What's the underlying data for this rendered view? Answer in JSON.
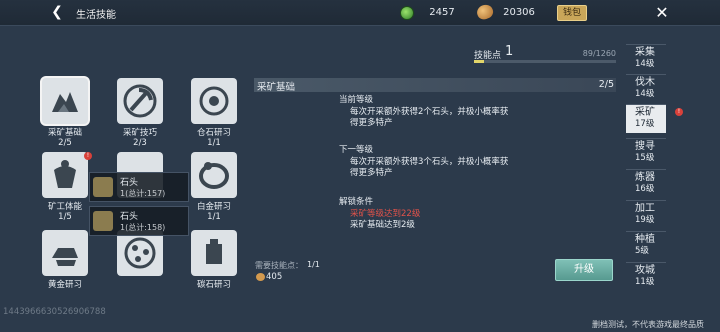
{
  "header": {
    "title": "生活技能",
    "currency_green": "2457",
    "currency_gold": "20306",
    "wallet_label": "钱包"
  },
  "skill_points": {
    "label": "技能点",
    "value": "1",
    "progress_text": "89/1260",
    "progress_fraction": 0.071
  },
  "skills": [
    {
      "name": "采矿基础",
      "level": "2/5"
    },
    {
      "name": "采矿技巧",
      "level": "2/3"
    },
    {
      "name": "仓石研习",
      "level": "1/1"
    },
    {
      "name": "矿工体能",
      "level": "1/5"
    },
    {
      "name": "",
      "level": ""
    },
    {
      "name": "白金研习",
      "level": "1/1"
    },
    {
      "name": "黄金研习",
      "level": ""
    },
    {
      "name": "",
      "level": ""
    },
    {
      "name": "碳石研习",
      "level": ""
    }
  ],
  "popups": [
    {
      "name": "石头",
      "total": "1(总计:157)"
    },
    {
      "name": "石头",
      "total": "1(总计:158)"
    }
  ],
  "detail": {
    "title": "采矿基础",
    "level": "2/5",
    "current_label": "当前等级",
    "current_desc_1": "每次开采额外获得2个石头，并极小概率获",
    "current_desc_2": "得更多特产",
    "next_label": "下一等级",
    "next_desc_1": "每次开采额外获得3个石头，并极小概率获",
    "next_desc_2": "得更多特产",
    "unlock_label": "解锁条件",
    "unlock_req_1": "采矿等级达到22级",
    "unlock_req_2": "采矿基础达到2级",
    "cost_label": "需要技能点：",
    "cost_value": "1/1",
    "cost_money": "405",
    "upgrade_label": "升级"
  },
  "side_tabs": [
    {
      "name": "采集",
      "level": "14级"
    },
    {
      "name": "伐木",
      "level": "14级"
    },
    {
      "name": "采矿",
      "level": "17级"
    },
    {
      "name": "搜寻",
      "level": "15级"
    },
    {
      "name": "炼器",
      "level": "16级"
    },
    {
      "name": "加工",
      "level": "19级"
    },
    {
      "name": "种植",
      "level": "5级"
    },
    {
      "name": "攻城",
      "level": "11级"
    }
  ],
  "footer": {
    "id_text": "1443966630526906788",
    "note": "删档测试，不代表游戏最终品质"
  },
  "colors": {
    "background": "#2c3a4b",
    "accent_teal": "#6fb0a6",
    "warning_red": "#e0524a",
    "wallet_gold": "#c9a659"
  },
  "icons": [
    "back-arrow-icon",
    "green-currency-icon",
    "gold-coin-icon",
    "close-icon",
    "red-dot-badge-icon"
  ]
}
